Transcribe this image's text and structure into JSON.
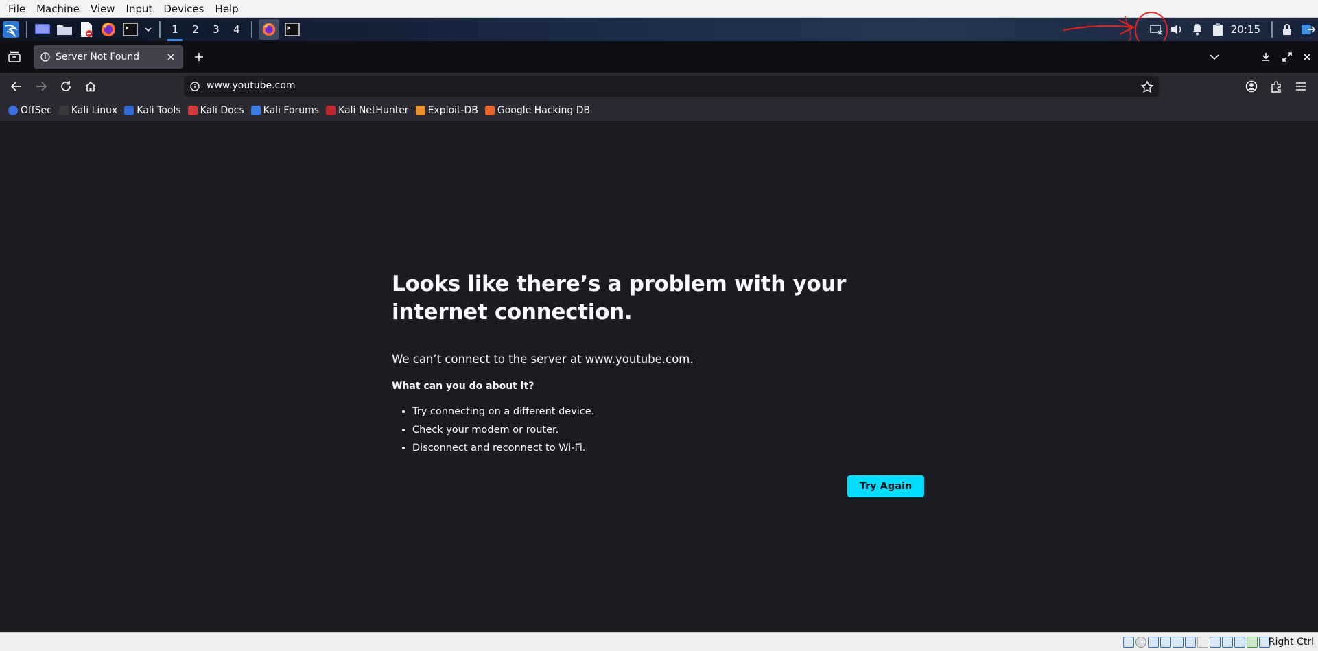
{
  "vbox_menu": [
    "File",
    "Machine",
    "View",
    "Input",
    "Devices",
    "Help"
  ],
  "panel": {
    "workspaces": [
      "1",
      "2",
      "3",
      "4"
    ],
    "clock": "20:15"
  },
  "browser": {
    "tab_title": "Server Not Found",
    "url": "www.youtube.com",
    "bookmarks": [
      {
        "label": "OffSec",
        "color": "#3b6fe0"
      },
      {
        "label": "Kali Linux",
        "color": "#1e1e1e"
      },
      {
        "label": "Kali Tools",
        "color": "#2f6bd8"
      },
      {
        "label": "Kali Docs",
        "color": "#d33b3b"
      },
      {
        "label": "Kali Forums",
        "color": "#3a7ee8"
      },
      {
        "label": "Kali NetHunter",
        "color": "#c4262e"
      },
      {
        "label": "Exploit-DB",
        "color": "#e8912b"
      },
      {
        "label": "Google Hacking DB",
        "color": "#e8652b"
      }
    ]
  },
  "error_page": {
    "title": "Looks like there’s a problem with your internet connection.",
    "description": "We can’t connect to the server at www.youtube.com.",
    "question": "What can you do about it?",
    "tips": [
      "Try connecting on a different device.",
      "Check your modem or router.",
      "Disconnect and reconnect to Wi-Fi."
    ],
    "button": "Try Again"
  },
  "vbox_status": {
    "host_key": "Right Ctrl"
  },
  "colors": {
    "accent_button": "#00ddff",
    "page_bg": "#1c1b22",
    "toolbar_bg": "#2b2a33",
    "annotation": "#e8231d"
  }
}
